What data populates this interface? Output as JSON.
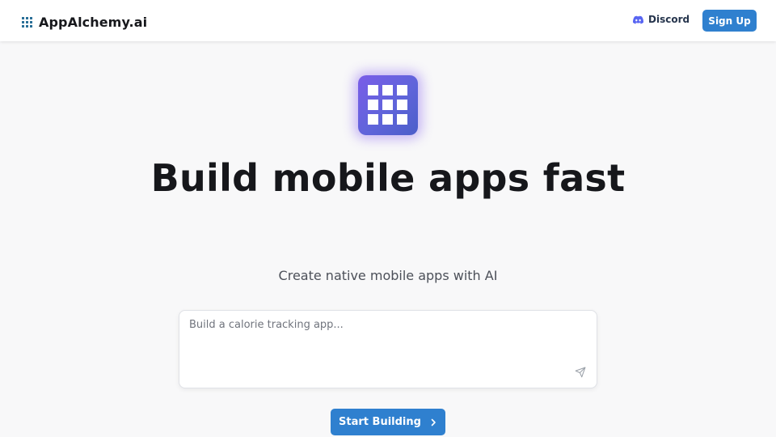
{
  "header": {
    "logo_icon": "grid-icon",
    "brand": "AppAlchemy.ai",
    "discord_icon": "discord-icon",
    "discord_label": "Discord",
    "signup_label": "Sign Up"
  },
  "hero": {
    "icon": "grid-icon",
    "headline": "Build mobile apps fast",
    "subheadline": "Create native mobile apps with AI"
  },
  "prompt": {
    "value": "",
    "placeholder": "Build a calorie tracking app...",
    "send_icon": "send-icon"
  },
  "cta": {
    "label": "Start Building",
    "icon": "chevron-right-icon"
  },
  "colors": {
    "accent": "#2f80cf",
    "hero_icon_gradient_start": "#7a5de8",
    "hero_icon_gradient_end": "#4b5ec9",
    "logo_icon": "#2a6f97",
    "background": "#f8f8f9"
  }
}
